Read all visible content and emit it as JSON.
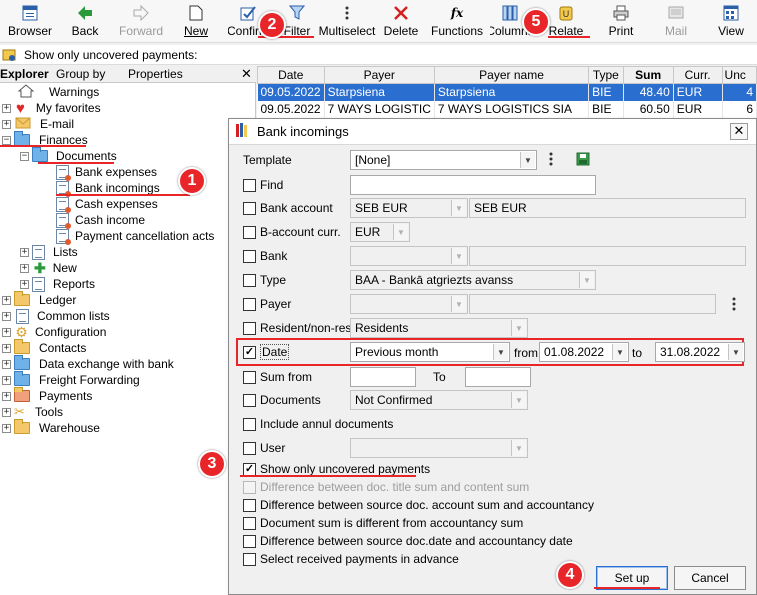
{
  "toolbar": {
    "buttons": [
      {
        "label": "Browser",
        "icon": "browser-icon"
      },
      {
        "label": "Back",
        "icon": "back-arrow-icon"
      },
      {
        "label": "Forward",
        "icon": "forward-arrow-icon"
      },
      {
        "label": "New",
        "icon": "new-document-icon"
      },
      {
        "label": "Confirm",
        "icon": "confirm-icon"
      },
      {
        "label": "Filter",
        "icon": "filter-icon"
      },
      {
        "label": "Multiselect",
        "icon": "multiselect-icon"
      },
      {
        "label": "Delete",
        "icon": "delete-icon"
      },
      {
        "label": "Functions",
        "icon": "functions-icon"
      },
      {
        "label": "Columns",
        "icon": "columns-icon"
      },
      {
        "label": "Relate",
        "icon": "relate-icon"
      },
      {
        "label": "Print",
        "icon": "print-icon"
      },
      {
        "label": "Mail",
        "icon": "mail-icon"
      },
      {
        "label": "View",
        "icon": "view-icon"
      }
    ]
  },
  "infobar": {
    "text": "Show only uncovered payments:"
  },
  "explorer": {
    "tabs": [
      "Explorer",
      "Group by",
      "Properties"
    ],
    "close": "✕",
    "tree": [
      {
        "label": "Warnings"
      },
      {
        "label": "My favorites"
      },
      {
        "label": "E-mail"
      },
      {
        "label": "Finances"
      },
      {
        "label": "Documents"
      },
      {
        "label": "Bank expenses"
      },
      {
        "label": "Bank incomings"
      },
      {
        "label": "Cash expenses"
      },
      {
        "label": "Cash income"
      },
      {
        "label": "Payment cancellation acts"
      },
      {
        "label": "Lists"
      },
      {
        "label": "New"
      },
      {
        "label": "Reports"
      },
      {
        "label": "Ledger"
      },
      {
        "label": "Common lists"
      },
      {
        "label": "Configuration"
      },
      {
        "label": "Contacts"
      },
      {
        "label": "Data exchange with bank"
      },
      {
        "label": "Freight Forwarding"
      },
      {
        "label": "Payments"
      },
      {
        "label": "Tools"
      },
      {
        "label": "Warehouse"
      }
    ]
  },
  "grid": {
    "columns": [
      "Date",
      "Payer",
      "Payer name",
      "Type",
      "Sum",
      "Curr.",
      "Unc"
    ],
    "rows": [
      [
        "09.05.2022",
        "Starpsiena",
        "Starpsiena",
        "BIE",
        "48.40",
        "EUR",
        "4"
      ],
      [
        "09.05.2022",
        "7 WAYS LOGISTIC",
        "7 WAYS LOGISTICS SIA",
        "BIE",
        "60.50",
        "EUR",
        "6"
      ]
    ]
  },
  "dialog": {
    "title": "Bank incomings",
    "close": "✕",
    "template": {
      "label": "Template",
      "value": "[None]"
    },
    "find": {
      "label": "Find",
      "value": ""
    },
    "bank_account": {
      "label": "Bank account",
      "code": "SEB EUR",
      "name": "SEB EUR"
    },
    "b_account_curr": {
      "label": "B-account curr.",
      "value": "EUR"
    },
    "bank": {
      "label": "Bank",
      "value": ""
    },
    "type": {
      "label": "Type",
      "value": "BAA - Bankā atgriezts avanss"
    },
    "payer": {
      "label": "Payer",
      "value": ""
    },
    "resident": {
      "label": "Resident/non-resid",
      "value": "Residents"
    },
    "date": {
      "label": "Date",
      "period": "Previous month",
      "from_label": "from",
      "from": "01.08.2022",
      "to_label": "to",
      "to": "31.08.2022"
    },
    "sum_from": {
      "label": "Sum from",
      "to_label": "To",
      "from": "",
      "to": ""
    },
    "documents": {
      "label": "Documents",
      "value": "Not Confirmed"
    },
    "include_annul": {
      "label": "Include  annul documents"
    },
    "user": {
      "label": "User",
      "value": ""
    },
    "uncovered": {
      "label": "Show only uncovered payments"
    },
    "diff_title_content": {
      "label": "Difference between doc. title sum and content sum"
    },
    "diff_source_accountancy": {
      "label": "Difference between source doc. account sum and accountancy"
    },
    "doc_sum_different": {
      "label": "Document sum is different from accountancy sum"
    },
    "diff_source_date": {
      "label": "Difference between source doc.date and accountancy date"
    },
    "select_received": {
      "label": "Select received  payments in advance"
    },
    "setup_button": "Set up",
    "cancel_button": "Cancel"
  },
  "badges": [
    "1",
    "2",
    "3",
    "4",
    "5"
  ],
  "colors": {
    "annotation_red": "#e8262a",
    "selection_blue": "#2a6fd0"
  }
}
